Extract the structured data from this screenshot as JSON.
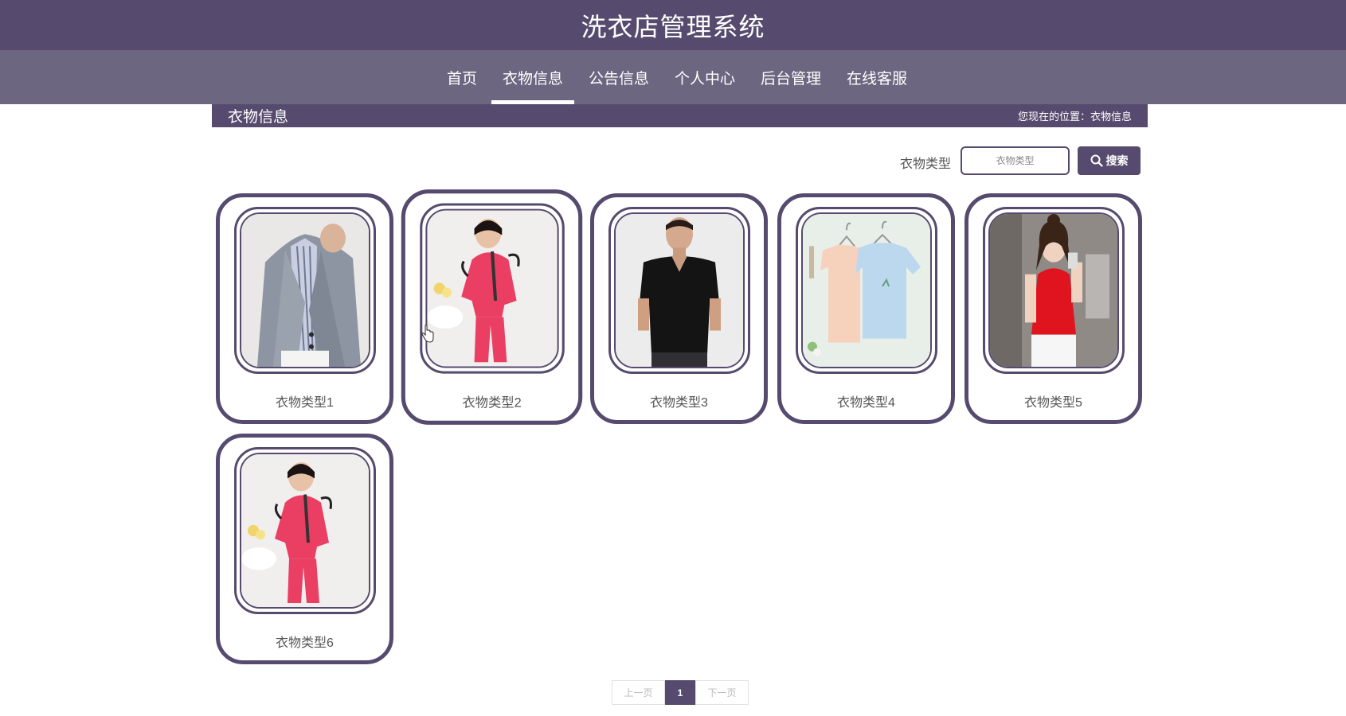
{
  "site": {
    "title": "洗衣店管理系统"
  },
  "nav": {
    "items": [
      {
        "label": "首页"
      },
      {
        "label": "衣物信息"
      },
      {
        "label": "公告信息"
      },
      {
        "label": "个人中心"
      },
      {
        "label": "后台管理"
      },
      {
        "label": "在线客服"
      }
    ],
    "active_index": 1
  },
  "section": {
    "title": "衣物信息",
    "breadcrumb": "您现在的位置：衣物信息"
  },
  "search": {
    "label": "衣物类型",
    "placeholder": "衣物类型",
    "button_label": "搜索",
    "button_icon": "search-icon"
  },
  "items": [
    {
      "name": "衣物类型1",
      "photo": "man-grey-blazer"
    },
    {
      "name": "衣物类型2",
      "photo": "girl-pink-tracksuit"
    },
    {
      "name": "衣物类型3",
      "photo": "man-black-tshirt"
    },
    {
      "name": "衣物类型4",
      "photo": "tshirts-on-hangers"
    },
    {
      "name": "衣物类型5",
      "photo": "woman-red-top"
    },
    {
      "name": "衣物类型6",
      "photo": "girl-pink-tracksuit"
    }
  ],
  "pagination": {
    "prev": "上一页",
    "current": "1",
    "next": "下一页"
  },
  "colors": {
    "primary": "#564b6e",
    "nav": "#6d6680"
  }
}
